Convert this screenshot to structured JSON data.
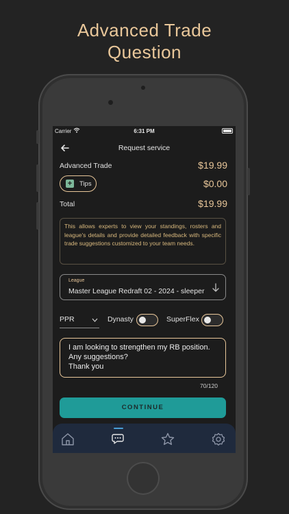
{
  "headline": {
    "line1": "Advanced Trade",
    "line2": "Question"
  },
  "status_bar": {
    "carrier": "Carrier",
    "time": "6:31 PM"
  },
  "nav": {
    "title": "Request service"
  },
  "pricing": {
    "service_label": "Advanced Trade",
    "service_price": "$19.99",
    "tips_label": "Tips",
    "tips_price": "$0.00",
    "total_label": "Total",
    "total_price": "$19.99"
  },
  "info_text": "This allows experts to view your standings, rosters and league's details and provide detailed feedback with specific trade suggestions customized to your team needs.",
  "league": {
    "label": "League",
    "value": "Master League Redraft 02 - 2024 - sleeper"
  },
  "options": {
    "scoring": "PPR",
    "dynasty_label": "Dynasty",
    "dynasty_on": false,
    "superflex_label": "SuperFlex",
    "superflex_on": false
  },
  "question": {
    "text": "I am looking to strengthen my RB position. Any suggestions?\nThank you",
    "counter": "70/120"
  },
  "continue_label": "CONTINUE",
  "tabs": [
    {
      "name": "home-icon",
      "active": false
    },
    {
      "name": "chat-icon",
      "active": true
    },
    {
      "name": "star-icon",
      "active": false
    },
    {
      "name": "settings-icon",
      "active": false
    }
  ],
  "colors": {
    "accent": "#e9c79a",
    "button": "#1f9b98",
    "tabbar": "#1f2a3d",
    "background": "#1c1c1c"
  }
}
